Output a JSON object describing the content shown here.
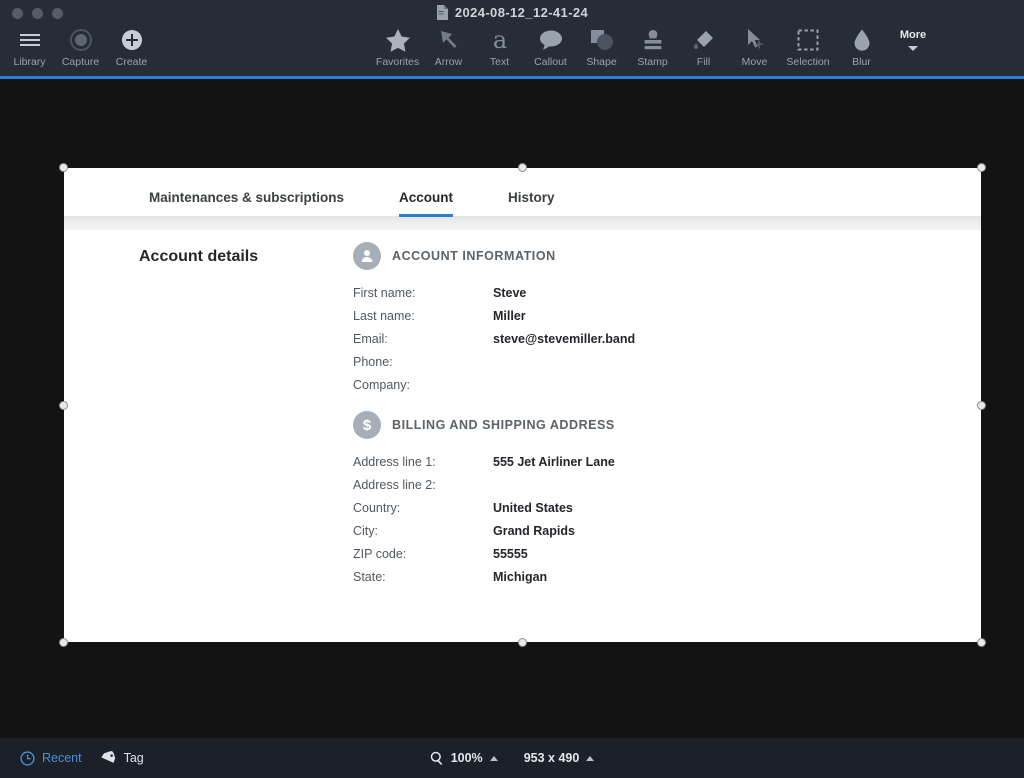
{
  "window": {
    "title": "2024-08-12_12-41-24",
    "title_icon": "document-icon",
    "accent_color": "#2a7fd4",
    "toolbar_bg": "#262c38",
    "canvas_bg": "#131313"
  },
  "toolbar": {
    "left_tools": [
      {
        "label": "Library",
        "icon": "hamburger-menu-icon"
      },
      {
        "label": "Capture",
        "icon": "capture-record-icon"
      },
      {
        "label": "Create",
        "icon": "plus-circle-icon"
      }
    ],
    "right_tools": [
      {
        "label": "Favorites",
        "icon": "star-icon"
      },
      {
        "label": "Arrow",
        "icon": "arrow-icon"
      },
      {
        "label": "Text",
        "icon": "text-a-icon"
      },
      {
        "label": "Callout",
        "icon": "callout-bubble-icon"
      },
      {
        "label": "Shape",
        "icon": "shape-square-circle-icon"
      },
      {
        "label": "Stamp",
        "icon": "stamp-icon"
      },
      {
        "label": "Fill",
        "icon": "paint-fill-icon"
      },
      {
        "label": "Move",
        "icon": "move-cursor-icon"
      },
      {
        "label": "Selection",
        "icon": "marquee-selection-icon"
      },
      {
        "label": "Blur",
        "icon": "blur-droplet-icon"
      }
    ],
    "more": {
      "label": "More",
      "icon": "chevron-down-icon"
    }
  },
  "document": {
    "tabs": [
      {
        "label": "Maintenances & subscriptions",
        "active": false
      },
      {
        "label": "Account",
        "active": true
      },
      {
        "label": "History",
        "active": false
      }
    ],
    "section_title": "Account details",
    "panels": [
      {
        "heading": "ACCOUNT INFORMATION",
        "icon": "user-avatar-icon",
        "fields": [
          {
            "key": "First name:",
            "value": "Steve"
          },
          {
            "key": "Last name:",
            "value": "Miller"
          },
          {
            "key": "Email:",
            "value": "steve@stevemiller.band"
          },
          {
            "key": "Phone:",
            "value": ""
          },
          {
            "key": "Company:",
            "value": ""
          }
        ]
      },
      {
        "heading": "BILLING AND SHIPPING ADDRESS",
        "icon": "dollar-sign-icon",
        "fields": [
          {
            "key": "Address line 1:",
            "value": "555 Jet Airliner Lane"
          },
          {
            "key": "Address line 2:",
            "value": ""
          },
          {
            "key": "Country:",
            "value": "United States"
          },
          {
            "key": "City:",
            "value": "Grand Rapids"
          },
          {
            "key": "ZIP code:",
            "value": "55555"
          },
          {
            "key": "State:",
            "value": "Michigan"
          }
        ]
      }
    ]
  },
  "statusbar": {
    "recent": {
      "label": "Recent",
      "icon": "clock-icon",
      "color": "#4a90d9"
    },
    "tag": {
      "label": "Tag",
      "icon": "tag-icon"
    },
    "zoom": {
      "label": "100%",
      "icon": "magnifier-icon"
    },
    "dimensions": {
      "label": "953 x 490"
    }
  }
}
